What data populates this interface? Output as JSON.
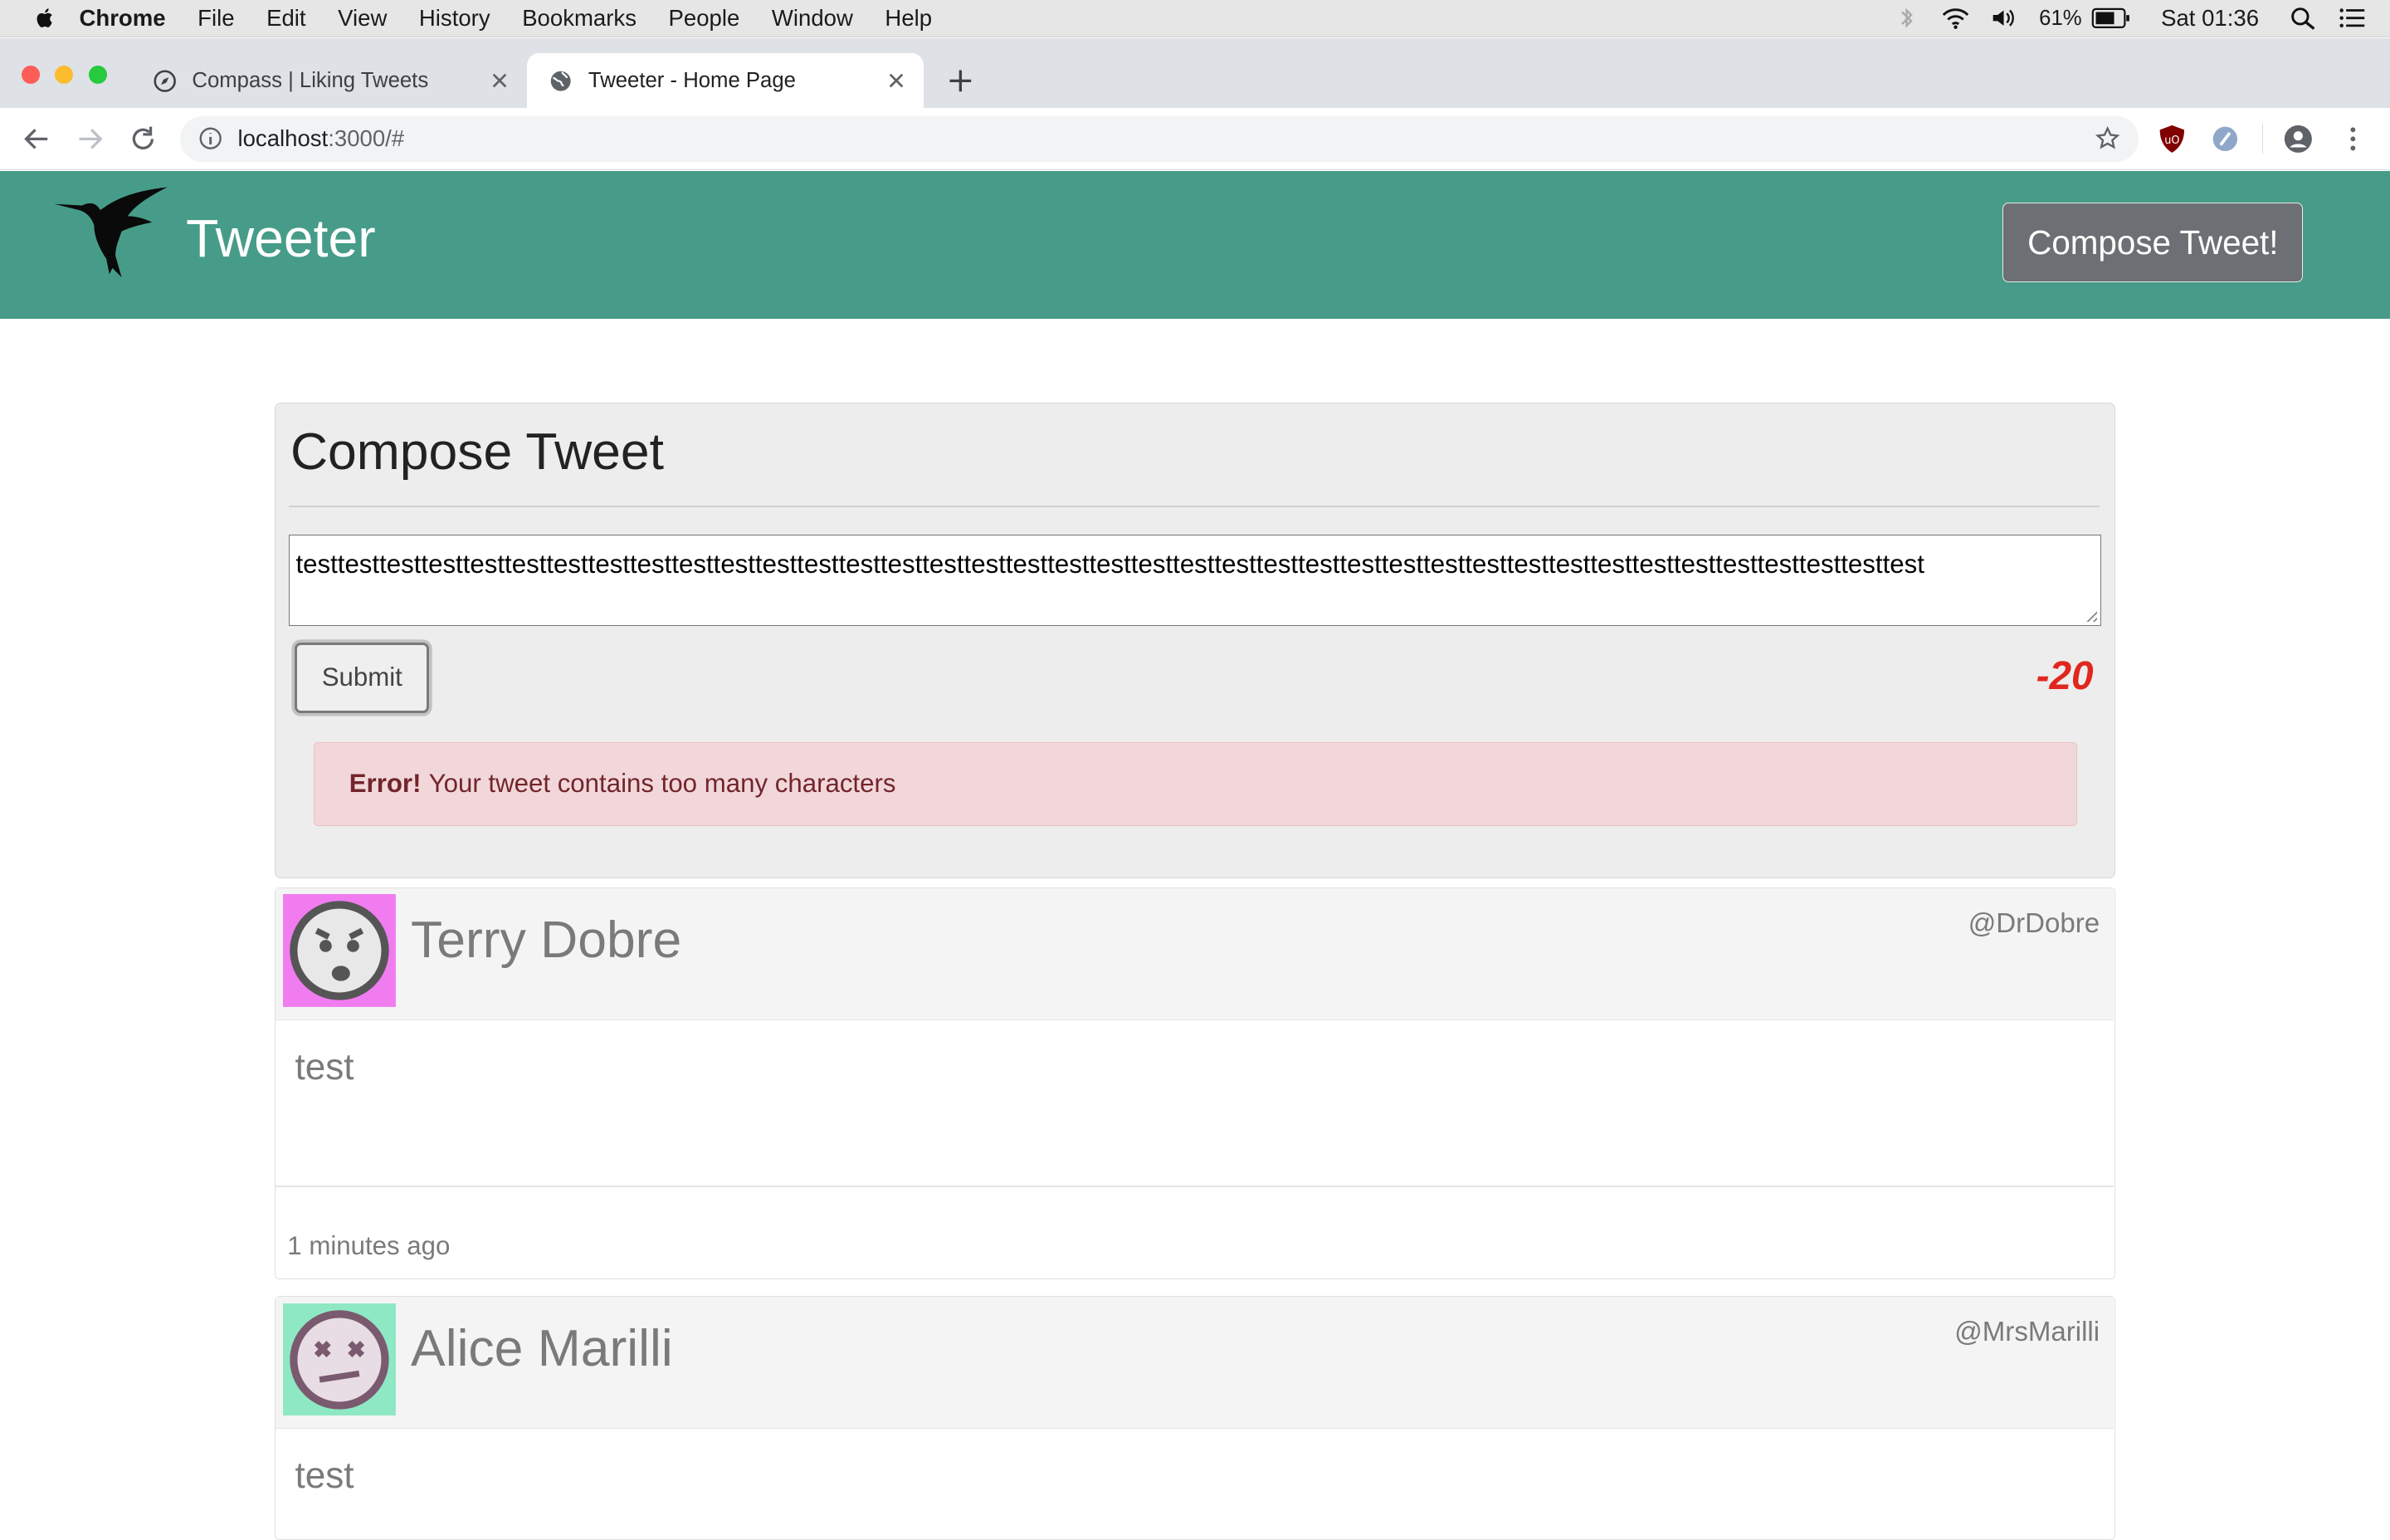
{
  "menubar": {
    "app": "Chrome",
    "items": [
      "File",
      "Edit",
      "View",
      "History",
      "Bookmarks",
      "People",
      "Window",
      "Help"
    ],
    "battery": "61%",
    "clock": "Sat 01:36"
  },
  "tabs": [
    {
      "title": "Compass | Liking Tweets",
      "icon": "compass-icon",
      "active": false
    },
    {
      "title": "Tweeter - Home Page",
      "icon": "globe-icon",
      "active": true
    }
  ],
  "address_bar": {
    "host": "localhost",
    "path": ":3000/#"
  },
  "navbar": {
    "brand": "Tweeter",
    "logo": "hummingbird-logo",
    "compose_button": "Compose Tweet!",
    "bg_color": "#469c88"
  },
  "compose": {
    "title": "Compose Tweet",
    "text": "testtesttesttesttesttesttesttesttesttesttesttesttesttesttesttesttesttesttesttesttesttesttesttesttesttesttesttesttesttesttesttesttesttesttesttesttesttesttest",
    "submit_label": "Submit",
    "counter": "-20",
    "error_strong": "Error!",
    "error_message": "Your tweet contains too many characters"
  },
  "tweets": [
    {
      "name": "Terry Dobre",
      "handle": "@DrDobre",
      "text": "test",
      "time": "1 minutes ago",
      "avatar_bg": "#f07cf0",
      "avatar_icon": "scared-face-icon"
    },
    {
      "name": "Alice Marilli",
      "handle": "@MrsMarilli",
      "text": "test",
      "time": "",
      "avatar_bg": "#8ee8c4",
      "avatar_icon": "dizzy-face-icon"
    }
  ]
}
